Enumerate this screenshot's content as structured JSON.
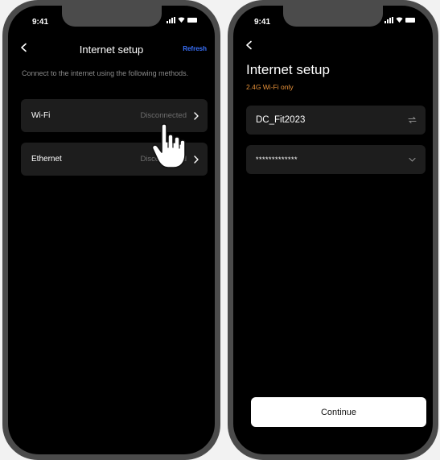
{
  "left_phone": {
    "status_bar": {
      "time": "9:41"
    },
    "header": {
      "title": "Internet setup",
      "refresh_label": "Refresh"
    },
    "description": "Connect to the internet using the following methods.",
    "methods": [
      {
        "label": "Wi-Fi",
        "status": "Disconnected"
      },
      {
        "label": "Ethernet",
        "status": "Disconnected"
      }
    ]
  },
  "right_phone": {
    "status_bar": {
      "time": "9:41"
    },
    "title": "Internet setup",
    "subtitle": "2.4G Wi-Fi only",
    "network_field": {
      "value": "DC_Fit2023",
      "icon": "swap-icon"
    },
    "password_field": {
      "value": "*************",
      "icon": "chevron-down-icon"
    },
    "continue_label": "Continue"
  },
  "colors": {
    "background": "#000000",
    "card": "#1d1d1d",
    "accent_blue": "#3b73ff",
    "accent_orange": "#e8923a",
    "muted_text": "#6e6e6e"
  }
}
